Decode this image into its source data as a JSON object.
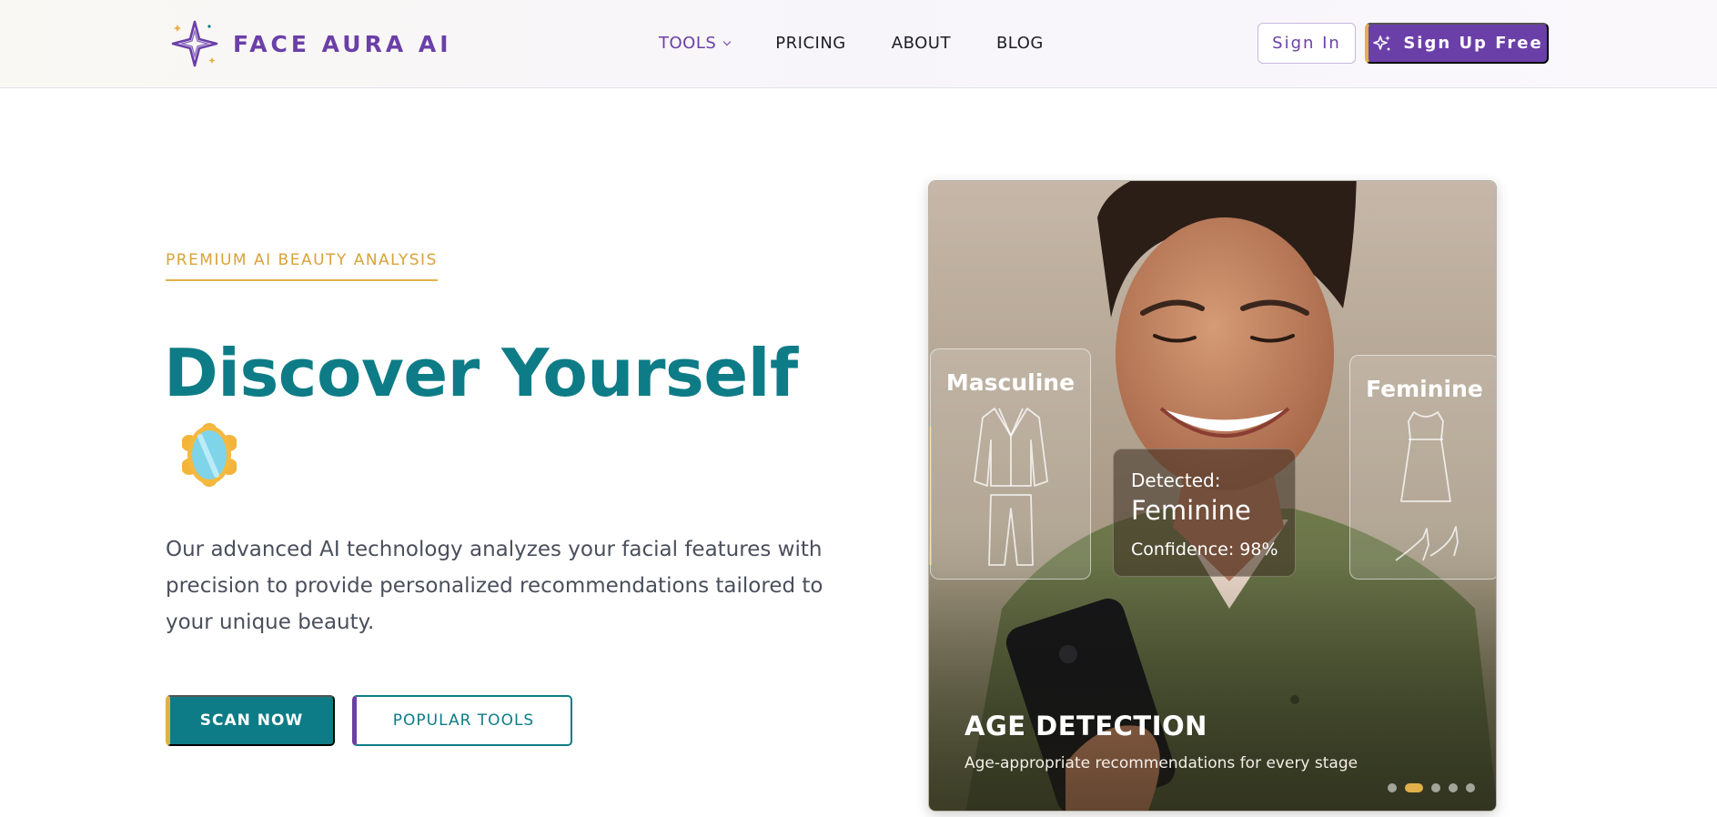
{
  "brand": {
    "name": "FACE AURA AI",
    "accent": "#6b3fa8",
    "teal": "#0e7c86",
    "gold": "#e2b04a"
  },
  "nav": {
    "links": [
      {
        "label": "TOOLS",
        "active": true,
        "has_dropdown": true
      },
      {
        "label": "PRICING",
        "active": false
      },
      {
        "label": "ABOUT",
        "active": false
      },
      {
        "label": "BLOG",
        "active": false
      }
    ],
    "signin_label": "Sign In",
    "signup_label": "Sign Up Free",
    "signup_icon": "sparkles-icon"
  },
  "hero": {
    "eyebrow": "PREMIUM AI BEAUTY ANALYSIS",
    "headline": "Discover Yourself",
    "emoji_icon": "mirror-icon",
    "description": "Our advanced AI technology analyzes your facial features with precision to provide personalized recommendations tailored to your unique beauty.",
    "primary_button": "SCAN NOW",
    "secondary_button": "POPULAR TOOLS"
  },
  "carousel": {
    "panel_left_title": "Masculine",
    "panel_right_title": "Feminine",
    "detected_label": "Detected:",
    "detected_value": "Feminine",
    "confidence": "Confidence: 98%",
    "slide_title": "AGE DETECTION",
    "slide_subtitle": "Age-appropriate recommendations for every stage",
    "slide_count": 5,
    "active_slide": 2
  }
}
